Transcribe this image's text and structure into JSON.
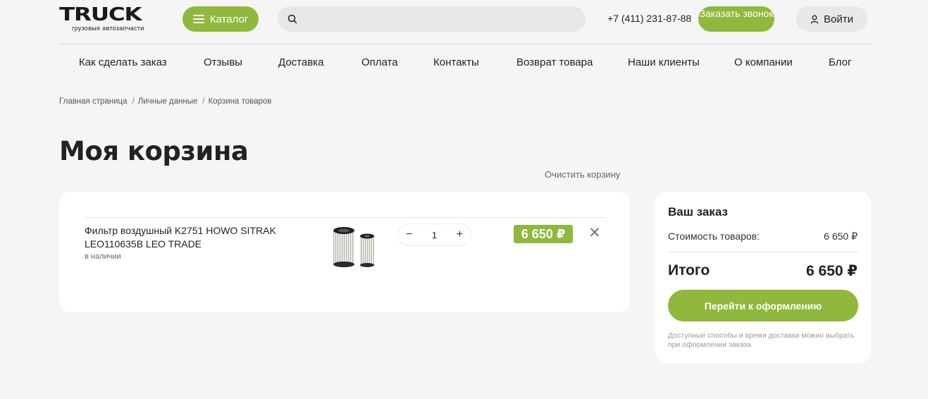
{
  "header": {
    "logo_text": "TRUCK",
    "logo_subtitle": "грузовые автозапчасти",
    "catalog_label": "Каталог",
    "search_placeholder": "",
    "phone": "+7 (411) 231-87-88",
    "callback_label": "Заказать звонок",
    "login_label": "Войти"
  },
  "nav": {
    "items": [
      "Как сделать заказ",
      "Отзывы",
      "Доставка",
      "Оплата",
      "Контакты",
      "Возврат товара",
      "Наши клиенты",
      "О компании",
      "Блог"
    ]
  },
  "breadcrumbs": [
    "Главная страница",
    "Личные данные",
    "Корзина товаров"
  ],
  "page": {
    "title": "Моя корзина",
    "clear_cart_label": "Очистить корзину"
  },
  "cart": {
    "items": [
      {
        "name": "Фильтр воздушный K2751 HOWO SITRAK LEO110635B LEO TRADE",
        "stock": "в наличии",
        "quantity": "1",
        "price": "6 650 ₽"
      }
    ]
  },
  "order": {
    "title": "Ваш заказ",
    "goods_cost_label": "Стоимость товаров:",
    "goods_cost_value": "6 650 ₽",
    "total_label": "Итого",
    "total_value": "6 650 ₽",
    "checkout_label": "Перейти к оформлению",
    "note": "Доступные способы и время доставки можно выбрать при оформлении заказа"
  },
  "icons": {
    "burger": "menu-icon",
    "search": "search-icon",
    "user": "user-icon",
    "minus": "minus-icon",
    "plus": "plus-icon",
    "remove": "close-icon"
  },
  "colors": {
    "accent": "#8fb83c",
    "background": "#f5f5f5",
    "card": "#ffffff"
  }
}
